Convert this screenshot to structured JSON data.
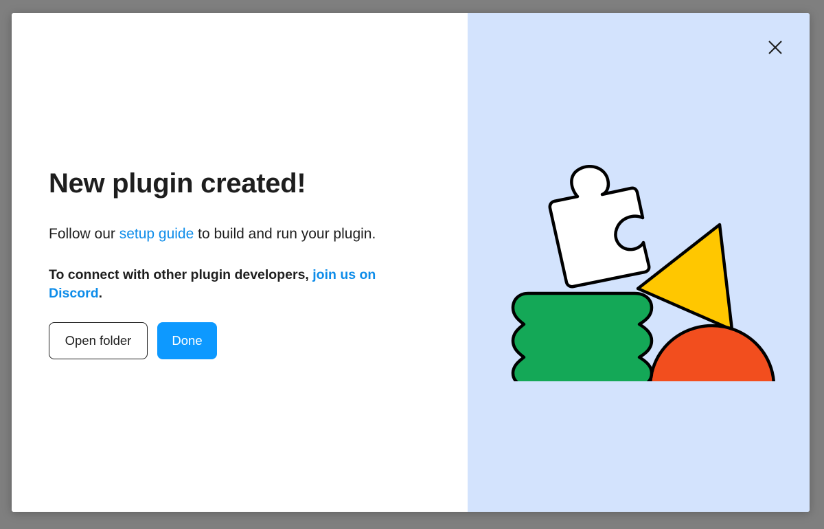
{
  "dialog": {
    "title": "New plugin created!",
    "setup_text_before": "Follow our ",
    "setup_link": "setup guide",
    "setup_text_after": " to build and run your plugin.",
    "connect_text": "To connect with other plugin developers, ",
    "discord_link": "join us on Discord",
    "connect_end": ".",
    "buttons": {
      "open_folder": "Open folder",
      "done": "Done"
    }
  },
  "icons": {
    "close": "close-icon",
    "illustration": "plugin-shapes-illustration"
  },
  "colors": {
    "accent": "#0d99ff",
    "link": "#0d8ce9",
    "panel": "#d3e3fd",
    "green": "#14a857",
    "yellow": "#ffc700",
    "orange": "#f24e1e"
  }
}
